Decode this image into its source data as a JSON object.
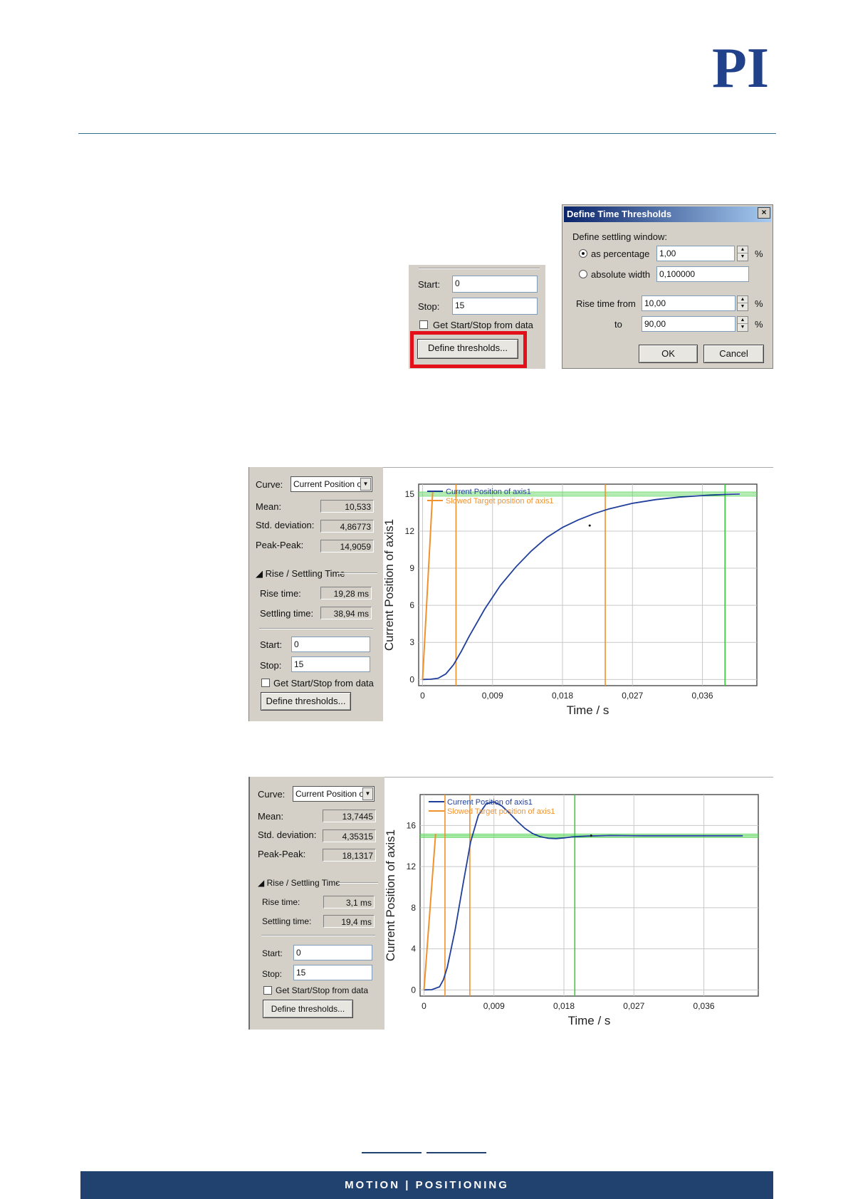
{
  "header": {
    "logo_text": "PI",
    "brand_color": "#21418a"
  },
  "crop_panel": {
    "start_label": "Start:",
    "start_value": "0",
    "stop_label": "Stop:",
    "stop_value": "15",
    "get_from_data_label": "Get Start/Stop from data",
    "define_button": "Define thresholds..."
  },
  "dialog": {
    "title": "Define Time Thresholds",
    "close": "×",
    "section_label": "Define settling window:",
    "as_percentage_label": "as percentage",
    "as_percentage_value": "1,00",
    "percent_unit": "%",
    "absolute_width_label": "absolute width",
    "absolute_width_value": "0,100000",
    "rise_from_label": "Rise time  from",
    "rise_from_value": "10,00",
    "rise_to_label": "to",
    "rise_to_value": "90,00",
    "ok_button": "OK",
    "cancel_button": "Cancel"
  },
  "panels": [
    {
      "curve_label": "Curve:",
      "curve_value": "Current Position o",
      "mean_label": "Mean:",
      "mean_value": "10,533",
      "std_label": "Std. deviation:",
      "std_value": "4,86773",
      "pp_label": "Peak-Peak:",
      "pp_value": "14,9059",
      "section_label": "Rise / Settling Time",
      "rise_label": "Rise time:",
      "rise_value": "19,28 ms",
      "settling_label": "Settling time:",
      "settling_value": "38,94 ms",
      "start_label": "Start:",
      "start_value": "0",
      "stop_label": "Stop:",
      "stop_value": "15",
      "get_from_data_label": "Get Start/Stop from data",
      "define_button": "Define thresholds..."
    },
    {
      "curve_label": "Curve:",
      "curve_value": "Current Position o",
      "mean_label": "Mean:",
      "mean_value": "13,7445",
      "std_label": "Std. deviation:",
      "std_value": "4,35315",
      "pp_label": "Peak-Peak:",
      "pp_value": "18,1317",
      "section_label": "Rise / Settling Time",
      "rise_label": "Rise time:",
      "rise_value": "3,1 ms",
      "settling_label": "Settling time:",
      "settling_value": "19,4 ms",
      "start_label": "Start:",
      "start_value": "0",
      "stop_label": "Stop:",
      "stop_value": "15",
      "get_from_data_label": "Get Start/Stop from data",
      "define_button": "Define thresholds..."
    }
  ],
  "chart_data": [
    {
      "type": "line",
      "xlabel": "Time / s",
      "ylabel": "Current Position of axis1",
      "xlim": [
        -0.0005,
        0.043
      ],
      "ylim": [
        -0.5,
        15.8
      ],
      "xticks": [
        0,
        0.009,
        0.018,
        0.027,
        0.036
      ],
      "xtick_labels": [
        "0",
        "0,009",
        "0,018",
        "0,027",
        "0,036"
      ],
      "yticks": [
        0,
        3,
        6,
        9,
        12,
        15
      ],
      "ytick_labels": [
        "0",
        "3",
        "6",
        "9",
        "12",
        "15"
      ],
      "grid": true,
      "legend_position": "top-left",
      "series": [
        {
          "name": "Current Position of axis1",
          "color": "#1f3f9a",
          "x": [
            0,
            0.001,
            0.002,
            0.003,
            0.004,
            0.005,
            0.006,
            0.008,
            0.01,
            0.012,
            0.014,
            0.016,
            0.018,
            0.02,
            0.022,
            0.024,
            0.027,
            0.03,
            0.033,
            0.036,
            0.039,
            0.0408
          ],
          "y": [
            0,
            0.02,
            0.1,
            0.45,
            1.2,
            2.3,
            3.5,
            5.7,
            7.6,
            9.1,
            10.4,
            11.5,
            12.3,
            12.9,
            13.4,
            13.8,
            14.25,
            14.55,
            14.75,
            14.88,
            14.97,
            15.0
          ]
        },
        {
          "name": "Slowed Target position of axis1",
          "color": "#f0922e",
          "x": [
            0,
            0.0013
          ],
          "y": [
            0,
            15.2
          ]
        }
      ],
      "threshold_lines": {
        "vertical_orange": [
          0.0043,
          0.0235
        ],
        "vertical_green": [
          0.0389
        ],
        "horizontal_green": [
          14.85,
          15.0,
          15.15
        ]
      },
      "marker_point": {
        "x": 0.0215,
        "y": 12.45
      }
    },
    {
      "type": "line",
      "xlabel": "Time / s",
      "ylabel": "Current Position of axis1",
      "xlim": [
        -0.0005,
        0.043
      ],
      "ylim": [
        -0.6,
        19
      ],
      "xticks": [
        0,
        0.009,
        0.018,
        0.027,
        0.036
      ],
      "xtick_labels": [
        "0",
        "0,009",
        "0,018",
        "0,027",
        "0,036"
      ],
      "yticks": [
        0,
        4,
        8,
        12,
        16
      ],
      "ytick_labels": [
        "0",
        "4",
        "8",
        "12",
        "16"
      ],
      "grid": true,
      "legend_position": "top-left",
      "series": [
        {
          "name": "Current Position of axis1",
          "color": "#1f3f9a",
          "x": [
            0,
            0.001,
            0.002,
            0.0025,
            0.003,
            0.004,
            0.005,
            0.006,
            0.007,
            0.008,
            0.009,
            0.01,
            0.011,
            0.012,
            0.013,
            0.014,
            0.015,
            0.016,
            0.017,
            0.018,
            0.019,
            0.021,
            0.024,
            0.028,
            0.032,
            0.036,
            0.041
          ],
          "y": [
            0,
            0.02,
            0.3,
            1.0,
            2.2,
            5.8,
            10.2,
            14.4,
            17.0,
            18.1,
            18.3,
            17.9,
            17.2,
            16.4,
            15.7,
            15.2,
            14.9,
            14.75,
            14.72,
            14.78,
            14.88,
            14.97,
            15.02,
            15.0,
            15.0,
            15.0,
            15.0
          ]
        },
        {
          "name": "Slowed Target position of axis1",
          "color": "#f0922e",
          "x": [
            0,
            0.0015
          ],
          "y": [
            0,
            15.2
          ]
        }
      ],
      "threshold_lines": {
        "vertical_orange": [
          0.0027,
          0.0059
        ],
        "vertical_green": [
          0.0194
        ],
        "horizontal_green": [
          14.85,
          15.0,
          15.15
        ]
      },
      "marker_point": {
        "x": 0.0215,
        "y": 15.0
      }
    }
  ],
  "footer": {
    "tagline": "MOTION | POSITIONING"
  }
}
